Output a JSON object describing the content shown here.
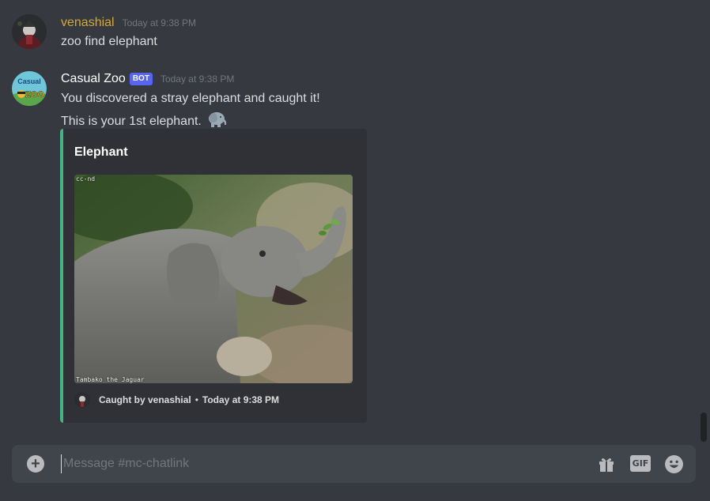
{
  "messages": [
    {
      "username": "venashial",
      "username_color": "#d4a836",
      "timestamp": "Today at 9:38 PM",
      "lines": [
        "zoo find elephant"
      ],
      "avatar_icon": "user-avatar"
    },
    {
      "username": "Casual Zoo",
      "username_color": "#ffffff",
      "bot_tag": "BOT",
      "timestamp": "Today at 9:38 PM",
      "lines": [
        "You discovered a stray elephant and caught it!",
        "This is your 1st elephant."
      ],
      "emoji": "elephant-emoji",
      "avatar_text": {
        "line1": "Casual",
        "line2": "ZOO"
      },
      "embed": {
        "accent_color": "#43b581",
        "title": "Elephant",
        "image_icon": "elephant-photo",
        "image_caption_top": "cc-nd",
        "image_caption_bottom": "Tambako the Jaguar",
        "footer_user": "Caught by venashial",
        "footer_separator": "•",
        "footer_time": "Today at 9:38 PM"
      }
    }
  ],
  "composer": {
    "placeholder": "Message #mc-chatlink",
    "value": "",
    "add_icon": "plus-circle-icon",
    "gift_icon": "gift-icon",
    "gif_label": "GIF",
    "emoji_icon": "smiley-icon"
  }
}
